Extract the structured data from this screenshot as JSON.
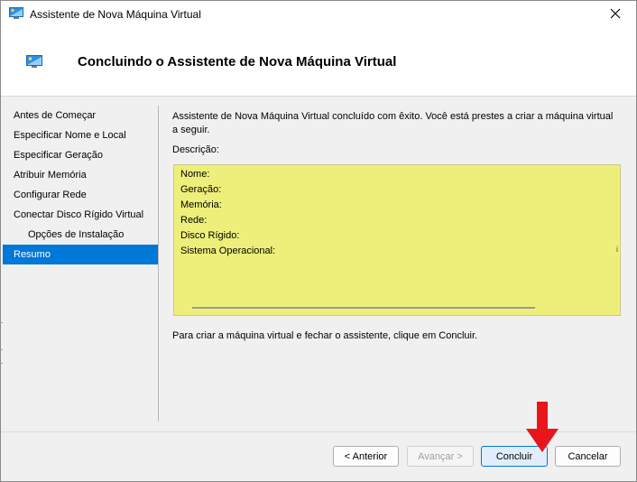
{
  "window": {
    "title": "Assistente de Nova Máquina Virtual"
  },
  "header": {
    "title": "Concluindo o Assistente de Nova Máquina Virtual"
  },
  "nav": {
    "items": [
      {
        "label": "Antes de Começar",
        "selected": false,
        "indent": false
      },
      {
        "label": "Especificar Nome e Local",
        "selected": false,
        "indent": false
      },
      {
        "label": "Especificar Geração",
        "selected": false,
        "indent": false
      },
      {
        "label": "Atribuir Memória",
        "selected": false,
        "indent": false
      },
      {
        "label": "Configurar Rede",
        "selected": false,
        "indent": false
      },
      {
        "label": "Conectar Disco Rígido Virtual",
        "selected": false,
        "indent": false
      },
      {
        "label": "Opções de Instalação",
        "selected": false,
        "indent": true
      },
      {
        "label": "Resumo",
        "selected": true,
        "indent": false
      }
    ]
  },
  "content": {
    "intro": "Assistente de Nova Máquina Virtual concluído com êxito. Você está prestes a criar a máquina virtual a seguir.",
    "description_label": "Descrição:",
    "summary": [
      "Nome:",
      "Geração:",
      "Memória:",
      "Rede:",
      "Disco Rígido:",
      "Sistema Operacional:"
    ],
    "summary_trunc": "і",
    "closing": "Para criar a máquina virtual e fechar o assistente, clique em Concluir."
  },
  "buttons": {
    "previous": "< Anterior",
    "next": "Avançar >",
    "finish": "Concluir",
    "cancel": "Cancelar"
  },
  "colors": {
    "selection": "#0078d7",
    "summary_bg": "#eeef7a",
    "arrow": "#e8151b"
  }
}
